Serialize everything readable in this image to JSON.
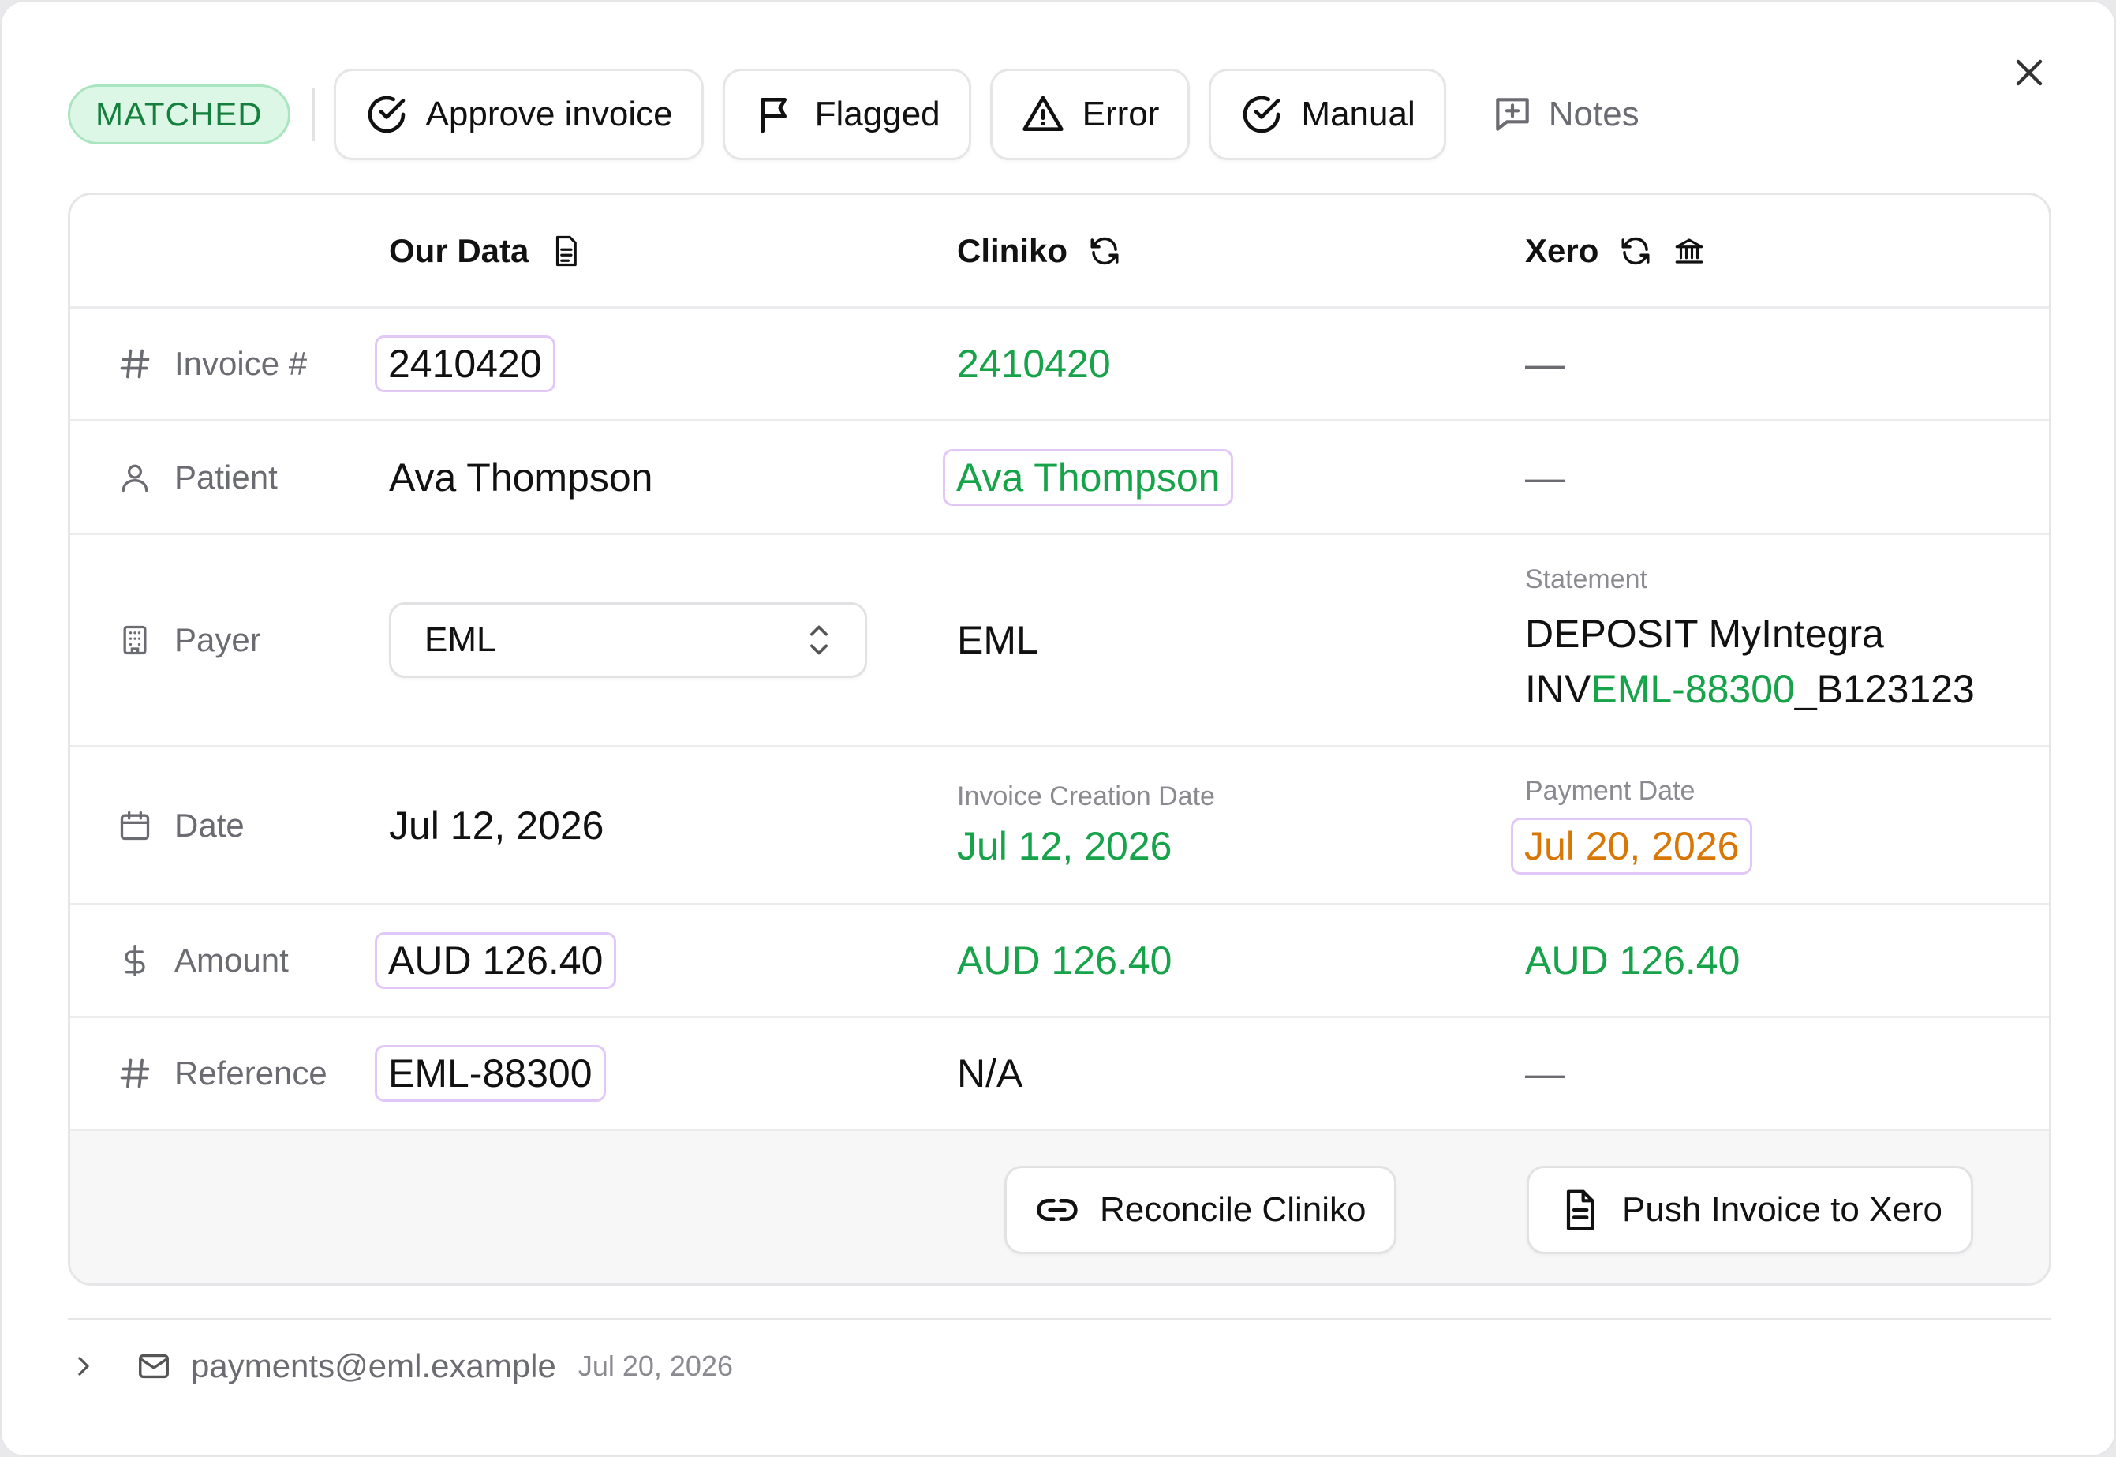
{
  "toolbar": {
    "status": "MATCHED",
    "approve_label": "Approve invoice",
    "flagged_label": "Flagged",
    "error_label": "Error",
    "manual_label": "Manual",
    "notes_label": "Notes"
  },
  "columns": {
    "ours": "Our Data",
    "cliniko": "Cliniko",
    "xero": "Xero"
  },
  "rows": {
    "invoice": {
      "label": "Invoice #",
      "ours": "2410420",
      "cliniko": "2410420",
      "xero": "—"
    },
    "patient": {
      "label": "Patient",
      "ours": "Ava Thompson",
      "cliniko": "Ava Thompson",
      "xero": "—"
    },
    "payer": {
      "label": "Payer",
      "ours_selected": "EML",
      "cliniko": "EML",
      "xero_sublabel": "Statement",
      "xero_line1": "DEPOSIT MyIntegra",
      "xero_line2_prefix": "INV",
      "xero_line2_match": "EML-88300",
      "xero_line2_suffix": "_B123123"
    },
    "date": {
      "label": "Date",
      "ours": "Jul 12, 2026",
      "cliniko_sublabel": "Invoice Creation Date",
      "cliniko": "Jul 12, 2026",
      "xero_sublabel": "Payment Date",
      "xero": "Jul 20, 2026"
    },
    "amount": {
      "label": "Amount",
      "ours": "AUD 126.40",
      "cliniko": "AUD 126.40",
      "xero": "AUD 126.40"
    },
    "reference": {
      "label": "Reference",
      "ours": "EML-88300",
      "cliniko": "N/A",
      "xero": "—"
    }
  },
  "actions": {
    "reconcile_label": "Reconcile Cliniko",
    "push_label": "Push Invoice to Xero"
  },
  "email": {
    "address": "payments@eml.example",
    "date": "Jul 20, 2026"
  },
  "colors": {
    "match_green": "#16a34a",
    "warning_orange": "#d97706",
    "highlight_border": "#e2c8f7",
    "badge_bg": "#dcf7e6"
  },
  "icons": [
    "check-circle-icon",
    "flag-icon",
    "warning-triangle-icon",
    "note-plus-icon",
    "close-icon",
    "document-icon",
    "refresh-icon",
    "bank-icon",
    "hash-icon",
    "user-icon",
    "building-icon",
    "calendar-icon",
    "dollar-icon",
    "chevron-updown-icon",
    "link-icon",
    "chevron-right-icon",
    "mail-icon"
  ]
}
